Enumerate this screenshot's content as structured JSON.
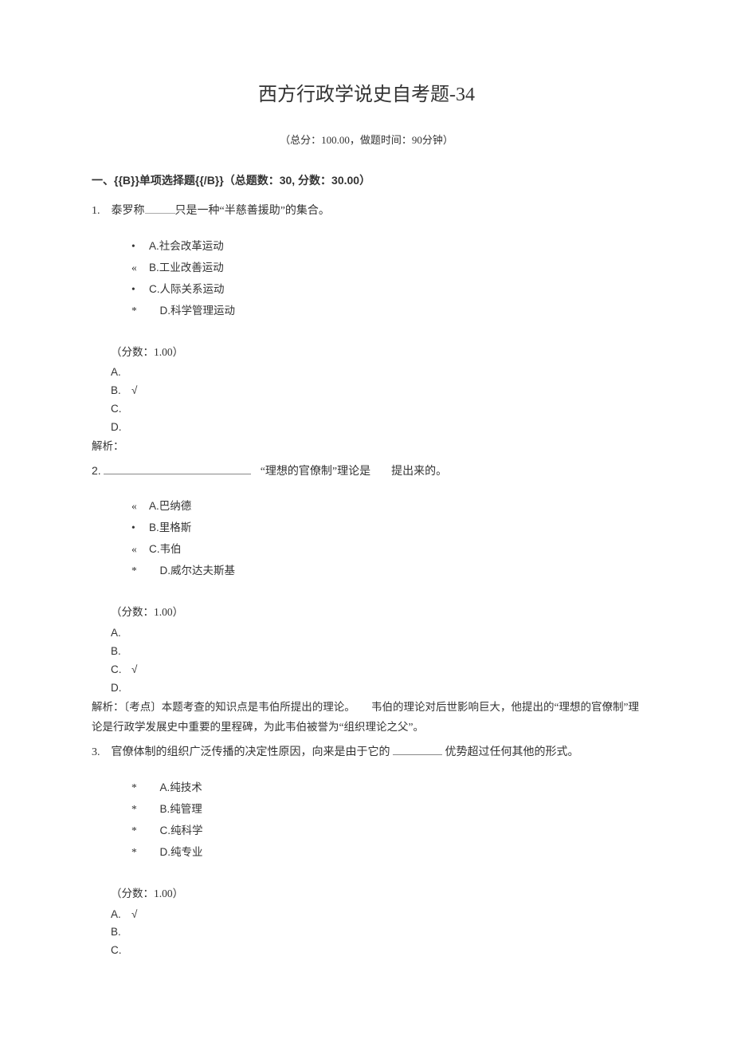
{
  "title": "西方行政学说史自考题-34",
  "subtitle": "（总分：100.00，做题时间：90分钟）",
  "section_heading": "一、{{B}}单项选择题{{/B}}（总题数：30, 分数：30.00）",
  "q1": {
    "stem_prefix": "1. 泰罗称",
    "stem_suffix": "只是一种“半慈善援助”的集合。",
    "options": [
      {
        "bullet": "•",
        "text": "A.社会改革运动"
      },
      {
        "bullet": "«",
        "text": "B.工业改善运动"
      },
      {
        "bullet": "•",
        "text": "C.人际关系运动"
      },
      {
        "bullet": "*",
        "text": "　D.科学管理运动"
      }
    ],
    "score": "（分数：1.00）",
    "answers": [
      {
        "letter": "A.",
        "mark": ""
      },
      {
        "letter": "B.",
        "mark": "√"
      },
      {
        "letter": "C.",
        "mark": ""
      },
      {
        "letter": "D.",
        "mark": ""
      }
    ],
    "analysis": "解析："
  },
  "q2": {
    "num_prefix": "2.",
    "stem_mid": "“理想的官僚制”理论是",
    "stem_suffix": "提出来的。",
    "options": [
      {
        "bullet": "«",
        "text": "A.巴纳德"
      },
      {
        "bullet": "•",
        "text": "B.里格斯"
      },
      {
        "bullet": "«",
        "text": "C.韦伯"
      },
      {
        "bullet": "*",
        "text": "　D.威尔达夫斯基"
      }
    ],
    "score": "（分数：1.00）",
    "answers": [
      {
        "letter": "A.",
        "mark": ""
      },
      {
        "letter": "B.",
        "mark": ""
      },
      {
        "letter": "C.",
        "mark": "√"
      },
      {
        "letter": "D.",
        "mark": ""
      }
    ],
    "analysis": "解析：〔考点〕本题考查的知识点是韦伯所提出的理论。　　韦伯的理论对后世影响巨大，他提出的“理想的官僚制”理论是行政学发展史中重要的里程碑，为此韦伯被誉为“组织理论之父”。"
  },
  "q3": {
    "stem_prefix": "3. 官僚体制的组织广泛传播的决定性原因，向来是由于它的",
    "stem_suffix": "优势超过任何其他的形式。",
    "options": [
      {
        "bullet": "*",
        "text": "　A.纯技术"
      },
      {
        "bullet": "*",
        "text": "　B.纯管理"
      },
      {
        "bullet": "*",
        "text": "　C.纯科学"
      },
      {
        "bullet": "*",
        "text": "　D.纯专业"
      }
    ],
    "score": "（分数：1.00）",
    "answers": [
      {
        "letter": "A.",
        "mark": "√"
      },
      {
        "letter": "B.",
        "mark": ""
      },
      {
        "letter": "C.",
        "mark": ""
      }
    ]
  }
}
